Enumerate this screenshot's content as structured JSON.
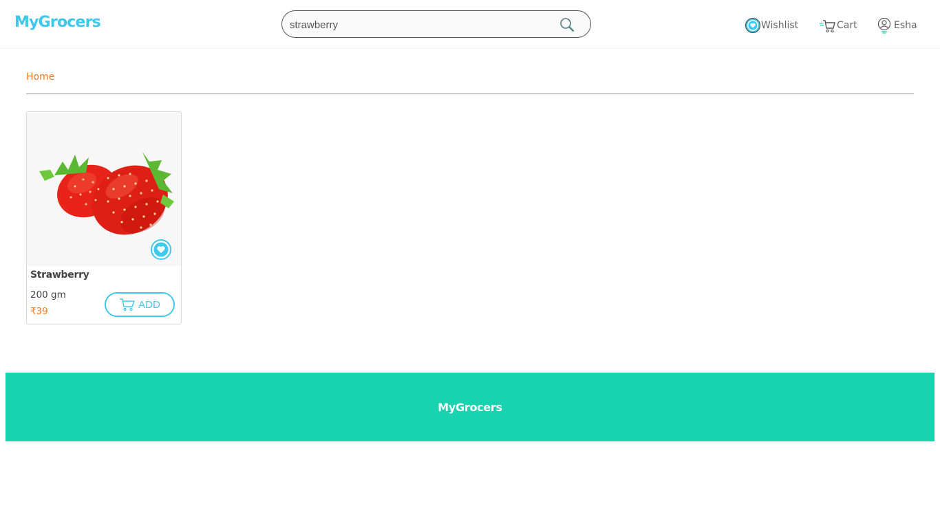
{
  "header": {
    "logo": "MyGrocers",
    "search": {
      "value": "strawberry",
      "placeholder": ""
    },
    "nav": {
      "wishlist": "Wishlist",
      "cart": "Cart",
      "user": "Esha"
    }
  },
  "breadcrumb": {
    "home": "Home"
  },
  "products": [
    {
      "name": "Strawberry",
      "quantity": "200 gm",
      "price": "₹39",
      "add_label": "ADD",
      "image_icon": "strawberry-image"
    }
  ],
  "footer": {
    "title": "MyGrocers"
  },
  "colors": {
    "brand": "#3fc8ee",
    "accent": "#f47a20",
    "footer_bg": "#18d2b0"
  }
}
